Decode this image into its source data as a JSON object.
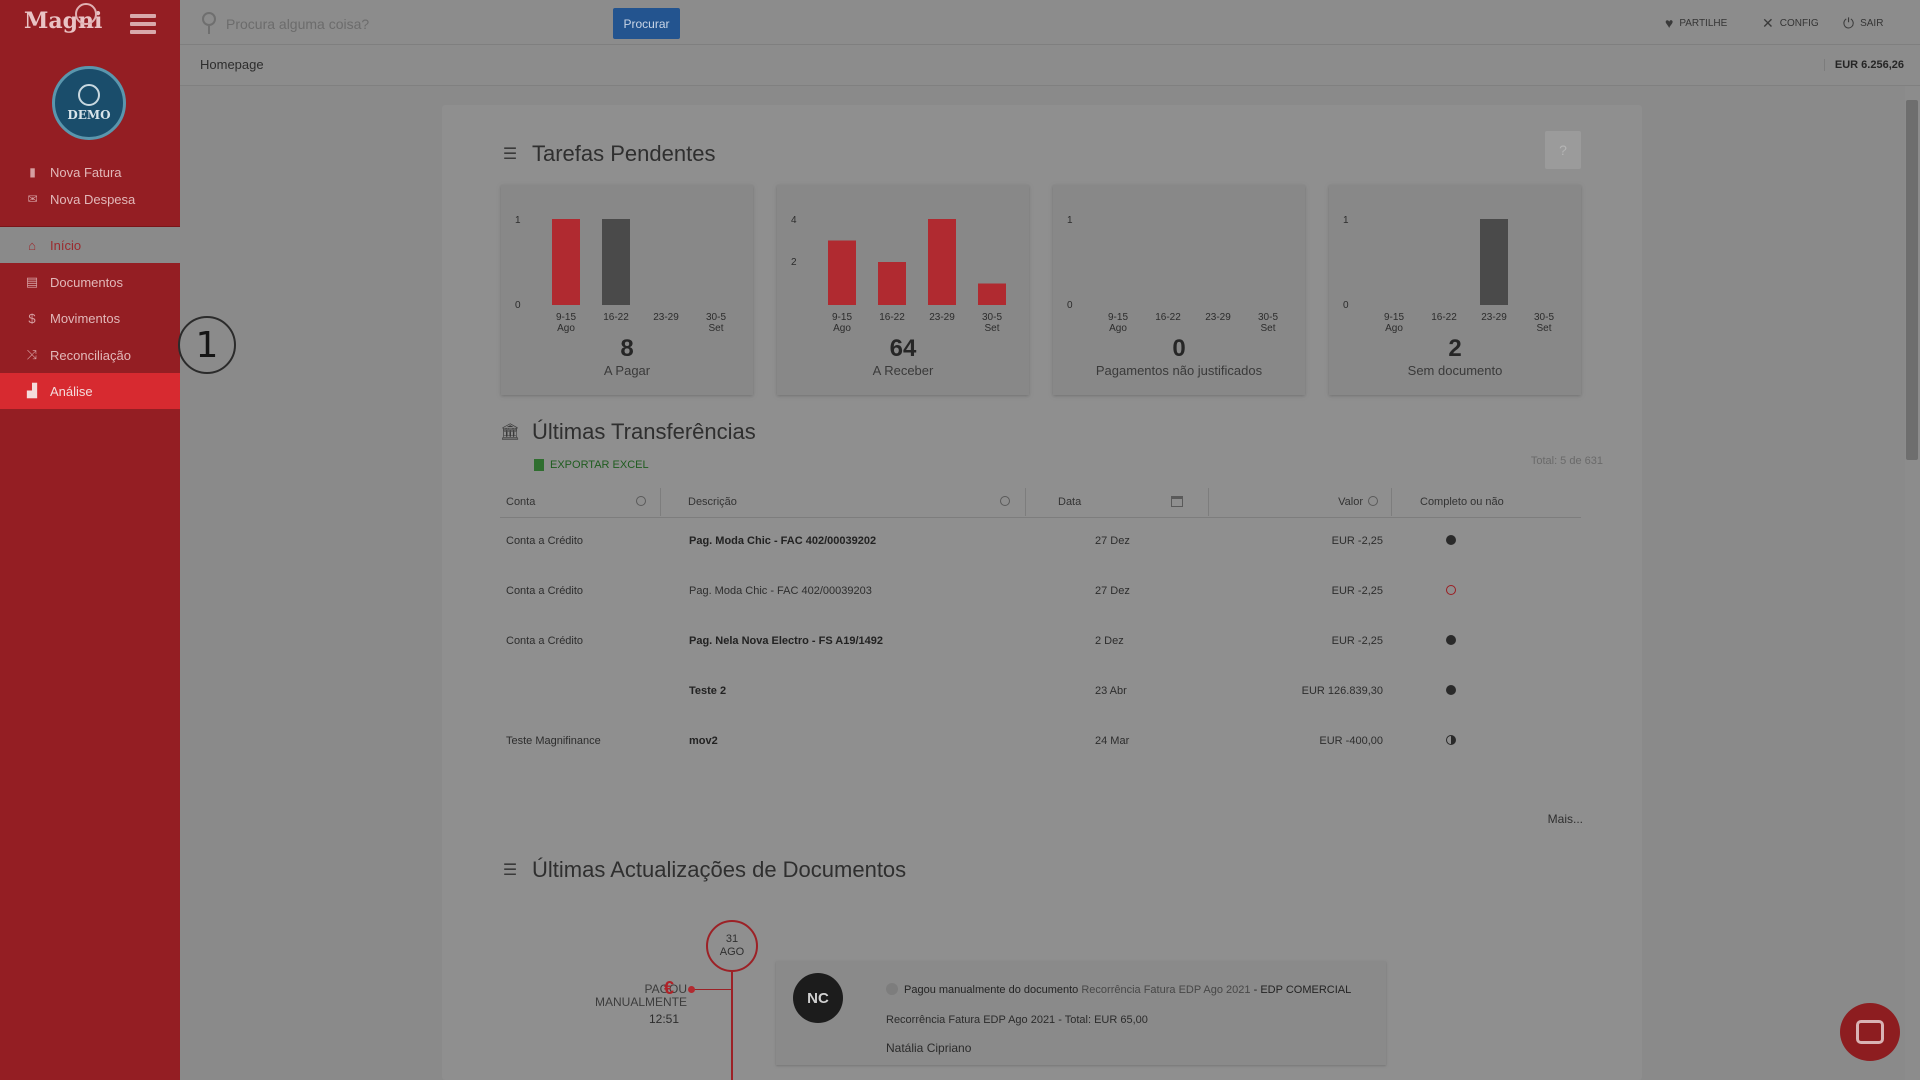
{
  "sidebar": {
    "logo": "Magni",
    "avatar_label": "DEMO",
    "quick_actions": [
      {
        "label": "Nova Fatura",
        "icon": "document-icon"
      },
      {
        "label": "Nova Despesa",
        "icon": "envelope-icon"
      }
    ],
    "menu": [
      {
        "label": "Início",
        "icon": "home-icon"
      },
      {
        "label": "Documentos",
        "icon": "documents-icon"
      },
      {
        "label": "Movimentos",
        "icon": "dollar-icon"
      },
      {
        "label": "Reconciliação",
        "icon": "shuffle-icon"
      },
      {
        "label": "Análise",
        "icon": "bar-chart-icon"
      }
    ]
  },
  "step_marker": "1",
  "topbar": {
    "search_placeholder": "Procura alguma coisa?",
    "search_button": "Procurar",
    "actions": [
      {
        "label": "PARTILHE",
        "icon": "heart-icon"
      },
      {
        "label": "CONFIG",
        "icon": "tools-icon"
      },
      {
        "label": "SAIR",
        "icon": "power-icon"
      }
    ]
  },
  "breadcrumb": "Homepage",
  "balance": "EUR 6.256,26",
  "tasks": {
    "title": "Tarefas Pendentes",
    "help": "?",
    "cards": [
      {
        "value": "8",
        "label": "A Pagar",
        "ymax": "1",
        "ymin": "0",
        "chart_data": {
          "type": "bar",
          "categories": [
            "9-15 Ago",
            "16-22",
            "23-29",
            "30-5 Set"
          ],
          "values": [
            1,
            1,
            0,
            0
          ],
          "colors": [
            "#b02a30",
            "#4a4a4a",
            "#4a4a4a",
            "#4a4a4a"
          ],
          "ylim": [
            0,
            1
          ]
        }
      },
      {
        "value": "64",
        "label": "A Receber",
        "ymax": "4",
        "ymin": "2",
        "chart_data": {
          "type": "bar",
          "categories": [
            "9-15 Ago",
            "16-22",
            "23-29",
            "30-5 Set"
          ],
          "values": [
            3,
            2,
            4,
            1
          ],
          "colors": [
            "#b02a30",
            "#b02a30",
            "#b02a30",
            "#b02a30"
          ],
          "ylim": [
            0,
            4
          ]
        }
      },
      {
        "value": "0",
        "label": "Pagamentos não justificados",
        "ymax": "1",
        "ymin": "0",
        "chart_data": {
          "type": "bar",
          "categories": [
            "9-15 Ago",
            "16-22",
            "23-29",
            "30-5 Set"
          ],
          "values": [
            0,
            0,
            0,
            0
          ],
          "colors": [
            "#4a4a4a",
            "#4a4a4a",
            "#4a4a4a",
            "#4a4a4a"
          ],
          "ylim": [
            0,
            1
          ]
        }
      },
      {
        "value": "2",
        "label": "Sem documento",
        "ymax": "1",
        "ymin": "0",
        "chart_data": {
          "type": "bar",
          "categories": [
            "9-15 Ago",
            "16-22",
            "23-29",
            "30-5 Set"
          ],
          "values": [
            0,
            0,
            1,
            0
          ],
          "colors": [
            "#4a4a4a",
            "#4a4a4a",
            "#4a4a4a",
            "#4a4a4a"
          ],
          "ylim": [
            0,
            1
          ]
        }
      }
    ]
  },
  "transfers": {
    "title": "Últimas Transferências",
    "export_label": "EXPORTAR EXCEL",
    "total": "Total: 5 de 631",
    "columns": [
      "Conta",
      "Descrição",
      "Data",
      "Valor",
      "Completo ou não"
    ],
    "rows": [
      {
        "conta": "Conta a Crédito",
        "descricao": "Pag. Moda Chic - FAC 402/00039202",
        "bold": true,
        "data": "27 Dez",
        "valor": "EUR -2,25",
        "status": "full"
      },
      {
        "conta": "Conta a Crédito",
        "descricao": "Pag. Moda Chic - FAC 402/00039203",
        "bold": false,
        "data": "27 Dez",
        "valor": "EUR -2,25",
        "status": "empty"
      },
      {
        "conta": "Conta a Crédito",
        "descricao": "Pag. Nela Nova Electro - FS A19/1492",
        "bold": true,
        "data": "2 Dez",
        "valor": "EUR -2,25",
        "status": "full"
      },
      {
        "conta": "",
        "descricao": "Teste 2",
        "bold": true,
        "data": "23 Abr",
        "valor": "EUR 126.839,30",
        "status": "full"
      },
      {
        "conta": "Teste Magnifinance",
        "descricao": "mov2",
        "bold": true,
        "data": "24 Mar",
        "valor": "EUR -400,00",
        "status": "half"
      }
    ],
    "more": "Mais..."
  },
  "updates": {
    "title": "Últimas Actualizações de Documentos",
    "date_day": "31",
    "date_month": "AGO",
    "event_label_1": "PAGOU",
    "event_label_2": "MANUALMENTE",
    "time": "12:51",
    "avatar_initials": "NC",
    "line1_action": "Pagou manualmente do documento",
    "line1_doc": "Recorrência Fatura EDP Ago 2021",
    "line1_sep": "-",
    "line1_entity": "EDP COMERCIAL",
    "line2": "Recorrência Fatura EDP Ago 2021 - Total: EUR 65,00",
    "line3": "Natália Cipriano"
  }
}
